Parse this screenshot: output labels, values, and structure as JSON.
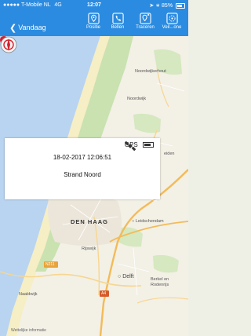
{
  "status_bar": {
    "carrier": "●●●●● T-Mobile NL",
    "network": "4G",
    "time": "12:07",
    "battery": "85%"
  },
  "toolbar": {
    "back_label": "Vandaag",
    "buttons": [
      {
        "label": "Positie",
        "icon": "location-pin-icon"
      },
      {
        "label": "Bellen",
        "icon": "phone-icon"
      },
      {
        "label": "Traceren",
        "icon": "trace-pin-icon"
      },
      {
        "label": "Veil...one",
        "icon": "safezone-icon"
      }
    ],
    "colors": {
      "accent": "#2b8be0",
      "text": "#ffffff"
    }
  },
  "map": {
    "colors": {
      "land": "#f3f0e6",
      "sea": "#b9d4f0",
      "beach": "#f6eec4",
      "green": "#c9e2b0",
      "road": "#f3bb58"
    },
    "labels": {
      "noordwijkerhout": "Noordwijkerhout",
      "noordwijk": "Noordwijk",
      "leiden": "eiden",
      "den_haag": "DEN HAAG",
      "leidschendam": "Leidschendam",
      "rijswijk": "Rijswijk",
      "n211": "N211",
      "delft": "Delft",
      "berkel": "Berkel en\nRodenrijs",
      "naaldwijk": "Naaldwijk",
      "a4": "A4"
    },
    "legal": "Wettelijke informatie"
  },
  "popup": {
    "gps_label": "GPS",
    "datetime": "18-02-2017 12:06:51",
    "place": "Strand Noord"
  }
}
